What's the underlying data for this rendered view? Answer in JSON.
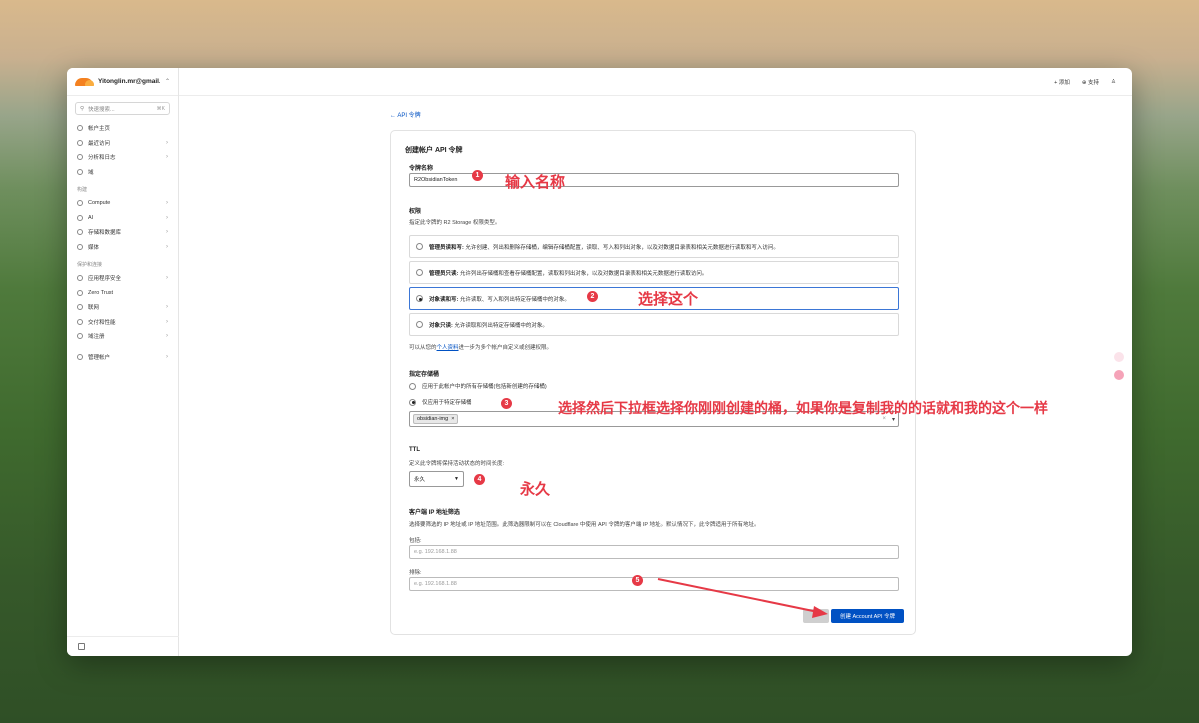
{
  "account": {
    "name": "Yitonglin.mr@gmail...."
  },
  "search": {
    "placeholder": "快速搜索...",
    "shortcut": "⌘K"
  },
  "sidebar": {
    "top_items": [
      {
        "label": "帐户主页",
        "icon": "home-icon",
        "arrow": ""
      },
      {
        "label": "最近访问",
        "icon": "clock-icon",
        "arrow": "›"
      },
      {
        "label": "分析和日志",
        "icon": "chart-icon",
        "arrow": "›"
      },
      {
        "label": "域",
        "icon": "globe-icon",
        "arrow": ""
      }
    ],
    "build_header": "构建",
    "build_items": [
      {
        "label": "Compute",
        "icon": "compute-icon",
        "arrow": "›"
      },
      {
        "label": "AI",
        "icon": "ai-icon",
        "arrow": "›"
      },
      {
        "label": "存储和数据库",
        "icon": "database-icon",
        "arrow": "›"
      },
      {
        "label": "媒体",
        "icon": "media-icon",
        "arrow": "›"
      }
    ],
    "protect_header": "保护和连接",
    "protect_items": [
      {
        "label": "应用程序安全",
        "icon": "shield-icon",
        "arrow": "›"
      },
      {
        "label": "Zero Trust",
        "icon": "zerotrust-icon",
        "arrow": ""
      },
      {
        "label": "联网",
        "icon": "network-icon",
        "arrow": "›"
      },
      {
        "label": "交付和性能",
        "icon": "lightning-icon",
        "arrow": "›"
      },
      {
        "label": "域注册",
        "icon": "registrar-icon",
        "arrow": "›"
      }
    ],
    "manage_item": {
      "label": "管理帐户",
      "icon": "gear-icon",
      "arrow": "›"
    }
  },
  "topbar": {
    "add": "+ 添加",
    "support": "⊕ 支持",
    "user": "♙"
  },
  "back_link": "← API 令牌",
  "form": {
    "title": "创建帐户 API 令牌",
    "token_name_label": "令牌名称",
    "token_name_value": "R2ObsidianToken",
    "permissions_label": "权限",
    "permissions_desc": "指定此令牌的 R2 Storage 权限类型。",
    "permissions": [
      {
        "title": "管理员读和写:",
        "desc": "允许创建、列出和删除存储桶，编辑存储桶配置，读取、写入和列出对象，以及对数据目录表和相关元数据进行读取和写入访问。",
        "selected": false
      },
      {
        "title": "管理员只读:",
        "desc": "允许列出存储桶和查看存储桶配置，读取和列出对象，以及对数据目录表和相关元数据进行读取访问。",
        "selected": false
      },
      {
        "title": "对象读和写:",
        "desc": "允许读取、写入和列出特定存储桶中的对象。",
        "selected": true
      },
      {
        "title": "对象只读:",
        "desc": "允许读取和列出特定存储桶中的对象。",
        "selected": false
      }
    ],
    "profile_note_pre": "可以从您的",
    "profile_note_link": "个人资料",
    "profile_note_post": "进一步为多个帐户自定义或创建权限。",
    "bucket_label": "指定存储桶",
    "bucket_opt_all": "应用于此帐户中的所有存储桶(包括新创建的存储桶)",
    "bucket_opt_specific": "仅应用于特定存储桶",
    "bucket_chip": "obsidian-img",
    "ttl_label": "TTL",
    "ttl_desc": "定义此令牌将保持活动状态的时间长度:",
    "ttl_value": "永久",
    "ip_label": "客户端 IP 地址筛选",
    "ip_desc": "选择要筛选的 IP 地址或 IP 地址范围。此筛选器限制可以在 Cloudflare 中使用 API 令牌的客户端 IP 地址。默认情况下，此令牌适用于所有地址。",
    "include_label": "包括:",
    "include_placeholder": "e.g. 192.168.1.88",
    "exclude_label": "排除:",
    "exclude_placeholder": "e.g. 192.168.1.88",
    "create_button": "创建 Account API 令牌"
  },
  "annotations": {
    "n1": "1",
    "t1": "输入名称",
    "n2": "2",
    "t2": "选择这个",
    "n3": "3",
    "t3": "选择然后下拉框选择你刚刚创建的桶，如果你是复制我的的话就和我的这个一样",
    "n4": "4",
    "t4": "永久",
    "n5": "5"
  },
  "colors": {
    "accent": "#0051c3",
    "annotation": "#e63946",
    "brand": "#f48120"
  }
}
